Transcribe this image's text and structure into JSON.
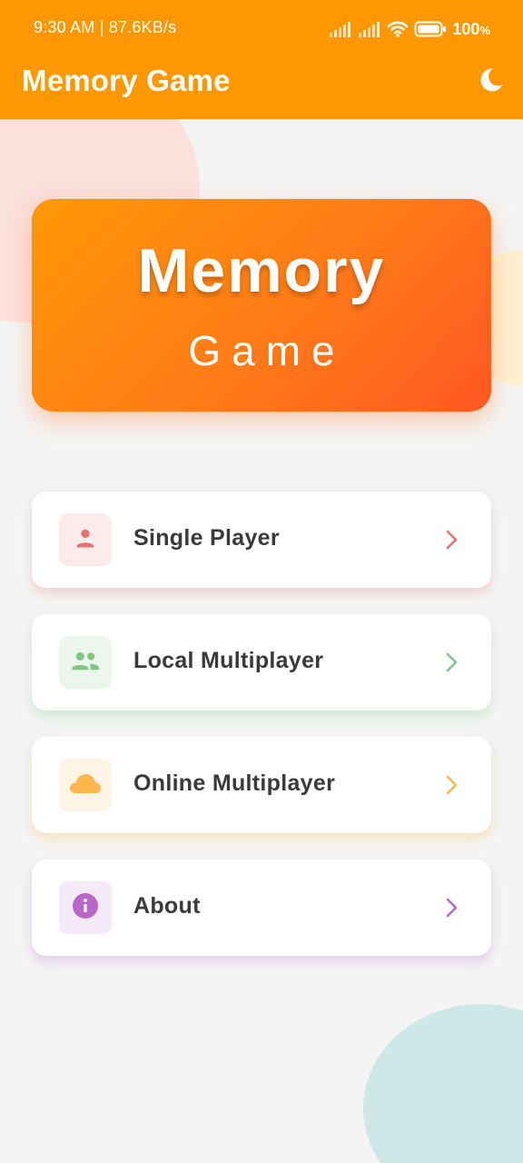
{
  "status_bar": {
    "time_speed": "9:30 AM | 87.6KB/s",
    "battery_percent": "100",
    "battery_unit": "%",
    "icons": [
      "signal-icon",
      "signal-icon",
      "wifi-icon",
      "battery-icon"
    ]
  },
  "app_bar": {
    "title": "Memory Game",
    "theme_toggle_icon": "moon-icon"
  },
  "hero": {
    "title": "Memory",
    "subtitle": "Game"
  },
  "menu": {
    "items": [
      {
        "label": "Single Player",
        "icon": "person-icon",
        "accent": "#e57373",
        "icon_bg": "#fcebeb"
      },
      {
        "label": "Local Multiplayer",
        "icon": "group-icon",
        "accent": "#81c784",
        "icon_bg": "#ecf6ec"
      },
      {
        "label": "Online Multiplayer",
        "icon": "cloud-icon",
        "accent": "#ffb74d",
        "icon_bg": "#fff5e6"
      },
      {
        "label": "About",
        "icon": "info-icon",
        "accent": "#ba68c8",
        "icon_bg": "#f5eaf7"
      }
    ]
  },
  "colors": {
    "primary": "#ff9800",
    "background": "#f4f4f4",
    "text": "#3a3a3a"
  }
}
